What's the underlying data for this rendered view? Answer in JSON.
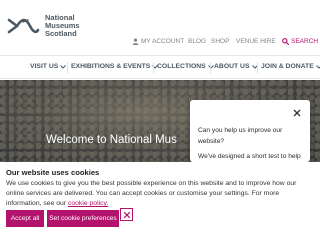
{
  "logo": {
    "line1": "National",
    "line2": "Museums",
    "line3": "Scotland"
  },
  "utility_nav": {
    "account": "MY ACCOUNT",
    "blog": "BLOG",
    "shop": "SHOP",
    "venue": "VENUE HIRE",
    "search": "SEARCH"
  },
  "main_nav": {
    "items": [
      {
        "label": "VISIT US"
      },
      {
        "label": "EXHIBITIONS & EVENTS"
      },
      {
        "label": "COLLECTIONS"
      },
      {
        "label": "ABOUT US"
      },
      {
        "label": "JOIN & DONATE"
      }
    ]
  },
  "hero": {
    "title": "Welcome to National Mus"
  },
  "survey": {
    "question": "Can you help us improve our website?",
    "body": "We've designed a short test to help"
  },
  "cookie": {
    "title": "Our website uses cookies",
    "text": "We use cookies to give you the best possible experience on this website and to improve how our online services are delivered. You can accept cookies or customise your settings. For more information, see our",
    "link": "cookie policy.",
    "accept_label": "Accept all",
    "prefs_label": "Set cookie preferences"
  },
  "colors": {
    "brand": "#b3126d",
    "nav_text": "#4d5863"
  }
}
